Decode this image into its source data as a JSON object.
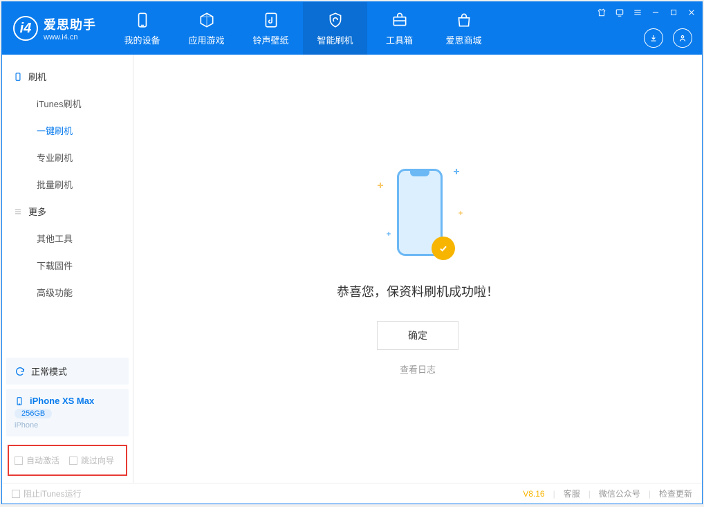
{
  "app": {
    "name": "爱思助手",
    "url": "www.i4.cn"
  },
  "nav": {
    "items": [
      {
        "label": "我的设备"
      },
      {
        "label": "应用游戏"
      },
      {
        "label": "铃声壁纸"
      },
      {
        "label": "智能刷机"
      },
      {
        "label": "工具箱"
      },
      {
        "label": "爱思商城"
      }
    ]
  },
  "sidebar": {
    "group1": {
      "title": "刷机",
      "items": [
        "iTunes刷机",
        "一键刷机",
        "专业刷机",
        "批量刷机"
      ]
    },
    "group2": {
      "title": "更多",
      "items": [
        "其他工具",
        "下载固件",
        "高级功能"
      ]
    },
    "status": "正常模式",
    "device": {
      "name": "iPhone XS Max",
      "capacity": "256GB",
      "type": "iPhone"
    },
    "options": {
      "opt1": "自动激活",
      "opt2": "跳过向导"
    }
  },
  "content": {
    "message": "恭喜您，保资料刷机成功啦！",
    "ok": "确定",
    "log": "查看日志"
  },
  "footer": {
    "stop_itunes": "阻止iTunes运行",
    "version": "V8.16",
    "links": [
      "客服",
      "微信公众号",
      "检查更新"
    ]
  }
}
